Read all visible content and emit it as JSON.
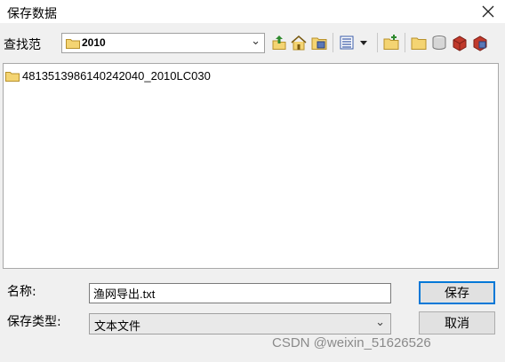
{
  "window": {
    "title": "保存数据"
  },
  "look_in": {
    "label": "查找范",
    "value": "2010"
  },
  "toolbar": {
    "icons": [
      "up-one-level-icon",
      "home-icon",
      "connect-folder-icon",
      "list-view-icon",
      "new-folder-icon",
      "folder-icon",
      "database-icon",
      "toolbox-icon",
      "catalog-icon"
    ]
  },
  "file_list": {
    "items": [
      {
        "name": "4813513986140242040_2010LC030",
        "type": "folder"
      }
    ]
  },
  "form": {
    "name_label": "名称:",
    "name_value": "渔网导出.txt",
    "type_label": "保存类型:",
    "type_value": "文本文件"
  },
  "buttons": {
    "save": "保存",
    "cancel": "取消"
  },
  "watermark": "CSDN @weixin_51626526",
  "colors": {
    "focus_border": "#0078d7",
    "folder_yellow": "#f4d472"
  }
}
